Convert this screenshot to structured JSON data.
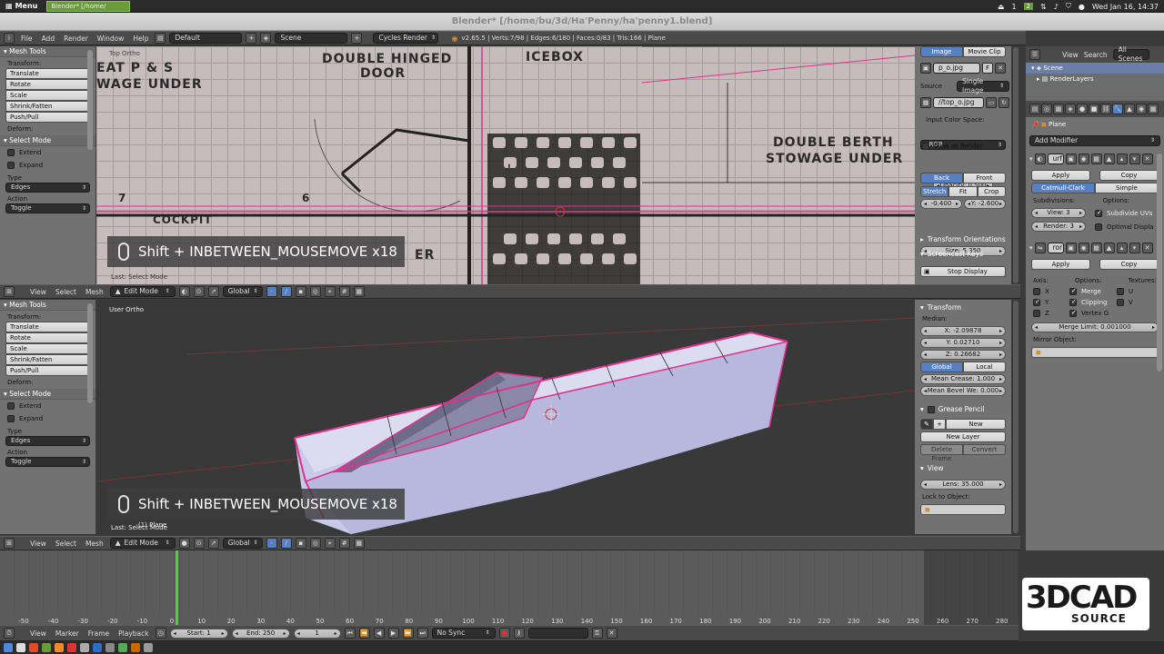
{
  "system_bar": {
    "menu_label": "Menu",
    "task_label": "Blender* [/home/",
    "workspace_1": "1",
    "workspace_2": "2",
    "clock": "Wed Jan 16, 14:37"
  },
  "window_title": "Blender* [/home/bu/3d/Ha'Penny/ha'penny1.blend]",
  "info_header": {
    "menus": [
      "File",
      "Add",
      "Render",
      "Window",
      "Help"
    ],
    "layout": "Default",
    "scene": "Scene",
    "engine": "Cycles Render",
    "stats": "v2.65.5 | Verts:7/98 | Edges:6/180 | Faces:0/83 | Tris:166 | Plane"
  },
  "tool_shelf_top": {
    "title": "Mesh Tools",
    "transform_label": "Transform:",
    "tools": [
      "Translate",
      "Rotate",
      "Scale",
      "Shrink/Fatten",
      "Push/Pull"
    ],
    "deform_label": "Deform:",
    "select_mode_title": "Select Mode",
    "extend": "Extend",
    "expand": "Expand",
    "type_label": "Type",
    "type_value": "Edges",
    "action_label": "Action",
    "action_value": "Toggle"
  },
  "tool_shelf_bottom": {
    "title": "Mesh Tools",
    "transform_label": "Transform:",
    "tools": [
      "Translate",
      "Rotate",
      "Scale",
      "Shrink/Fatten",
      "Push/Pull"
    ],
    "deform_label": "Deform:",
    "select_mode_title": "Select Mode",
    "extend": "Extend",
    "expand": "Expand",
    "type_label": "Type",
    "type_value": "Edges",
    "action_label": "Action",
    "action_value": "Toggle"
  },
  "top_viewport": {
    "view_name": "Top Ortho",
    "labels": [
      "EAT P & S",
      "WAGE UNDER",
      "DOUBLE HINGED",
      "DOOR",
      "ICEBOX",
      "DOUBLE BERTH",
      "STOWAGE UNDER",
      "COCKPIT",
      "7",
      "6",
      "ER"
    ],
    "screencast": "Shift + INBETWEEN_MOUSEMOVE x18",
    "last_op": "Last: Select Mode"
  },
  "bottom_viewport": {
    "view_name": "User Ortho",
    "screencast": "Shift + INBETWEEN_MOUSEMOVE x18",
    "last_op": "Last: Select Mode",
    "object_label": "(1) Plane"
  },
  "viewport_header": {
    "menus": [
      "View",
      "Select",
      "Mesh"
    ],
    "mode": "Edit Mode",
    "orientation": "Global"
  },
  "image_panel": {
    "tab_image": "Image",
    "tab_movie": "Movie Clip",
    "image_name": "p_o.jpg",
    "image_flag": "F",
    "source_label": "Source",
    "source_value": "Single Image",
    "filepath": "//top_o.jpg",
    "color_space_label": "Input Color Space:",
    "color_space": "sRGB",
    "view_as_render": "View as Render",
    "opacity": "Opacity: 0.500",
    "back": "Back",
    "front": "Front",
    "stretch": "Stretch",
    "fit": "Fit",
    "crop": "Crop",
    "offset_x": "-0.400",
    "offset_y": "Y: -2.600",
    "size": "Size: 5.350",
    "transform_orientations": "Transform Orientations",
    "screencast_keys": "Screencast Keys",
    "stop_display": "Stop Display"
  },
  "transform_panel": {
    "title": "Transform",
    "median_label": "Median:",
    "x": "X: -2.09878",
    "y": "Y: 0.02710",
    "z": "Z: 0.26682",
    "global": "Global",
    "local": "Local",
    "mean_crease": "Mean Crease: 1.000",
    "mean_bevel": "Mean Bevel We: 0.000",
    "grease_pencil": "Grease Pencil",
    "new": "New",
    "new_layer": "New Layer",
    "delete_frame": "Delete Frame",
    "convert": "Convert",
    "view_title": "View",
    "lens": "Lens: 35.000",
    "lock_to_object": "Lock to Object:"
  },
  "outliner": {
    "menus": [
      "View",
      "Search"
    ],
    "filter": "All Scenes",
    "scene": "Scene",
    "render_layers": "RenderLayers"
  },
  "properties": {
    "object": "Plane",
    "add_modifier": "Add Modifier",
    "mod1_name": "urf",
    "apply": "Apply",
    "copy": "Copy",
    "catmull_clark": "Catmull-Clark",
    "simple": "Simple",
    "subdivisions_label": "Subdivisions:",
    "options_label": "Options:",
    "view_levels": "View: 3",
    "render_levels": "Render: 3",
    "subdivide_uvs": "Subdivide UVs",
    "optimal_display": "Optimal Displa",
    "mod2_name": "ror",
    "axis_label": "Axis:",
    "textures_label": "Textures:",
    "x": "X",
    "y": "Y",
    "z": "Z",
    "merge": "Merge",
    "clipping": "Clipping",
    "vertex_g": "Vertex G",
    "u": "U",
    "v": "V",
    "merge_limit": "Merge Limit: 0.001000",
    "mirror_object": "Mirror Object:"
  },
  "timeline": {
    "ticks": [
      "-50",
      "-40",
      "-30",
      "-20",
      "-10",
      "0",
      "10",
      "20",
      "30",
      "40",
      "50",
      "60",
      "70",
      "80",
      "90",
      "100",
      "110",
      "120",
      "130",
      "140",
      "150",
      "160",
      "170",
      "180",
      "190",
      "200",
      "210",
      "220",
      "230",
      "240",
      "250",
      "260",
      "270",
      "280"
    ],
    "menus": [
      "View",
      "Marker",
      "Frame",
      "Playback"
    ],
    "start": "Start: 1",
    "end": "End: 250",
    "current": "1",
    "sync": "No Sync"
  },
  "logo": {
    "text_main": "3DCAD",
    "text_sub": "SOURCE"
  },
  "colors": {
    "accent_blue": "#5680c2",
    "selection_pink": "#e0318e",
    "panel_gray": "#727272",
    "header_gray": "#4a4a4a"
  }
}
